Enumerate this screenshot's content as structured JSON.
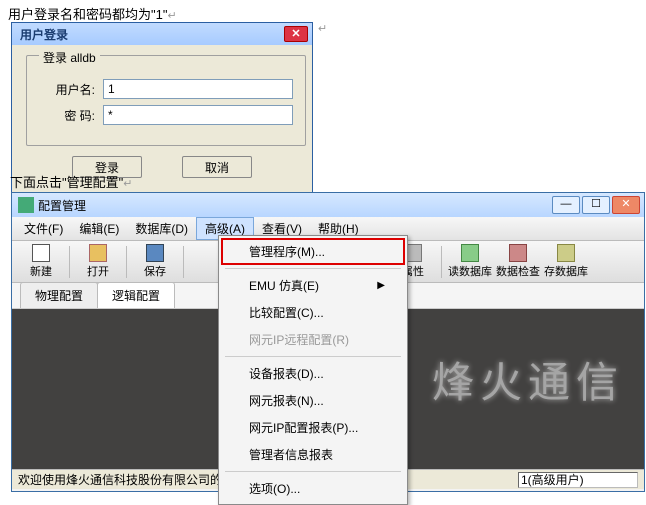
{
  "caption1": "用户登录名和密码都均为\"1\"",
  "caption2": "下面点击\"管理配置\"",
  "login": {
    "title": "用户登录",
    "fieldset_legend": "登录 alldb",
    "username_label": "用户名:",
    "username_value": "1",
    "password_label": "密  码:",
    "password_value": "*",
    "login_btn": "登录",
    "cancel_btn": "取消"
  },
  "config": {
    "title": "配置管理",
    "menu": {
      "file": "文件(F)",
      "edit": "编辑(E)",
      "db": "数据库(D)",
      "adv": "高级(A)",
      "view": "查看(V)",
      "help": "帮助(H)"
    },
    "toolbar": {
      "new": "新建",
      "open": "打开",
      "save": "保存",
      "props": "属性",
      "readdb": "读数据库",
      "datacheck": "数据检查",
      "savedb": "存数据库"
    },
    "tabs": {
      "phys": "物理配置",
      "logic": "逻辑配置"
    },
    "dropdown": {
      "manage": "管理程序(M)...",
      "emu": "EMU 仿真(E)",
      "compare": "比较配置(C)...",
      "remote": "网元IP远程配置(R)",
      "devreport": "设备报表(D)...",
      "nereport": "网元报表(N)...",
      "ipreport": "网元IP配置报表(P)...",
      "adminreport": "管理者信息报表",
      "options": "选项(O)..."
    },
    "watermark": "烽火通信",
    "status_left": "欢迎使用烽火通信科技股份有限公司的产品",
    "status_right": "1(高级用户)"
  }
}
